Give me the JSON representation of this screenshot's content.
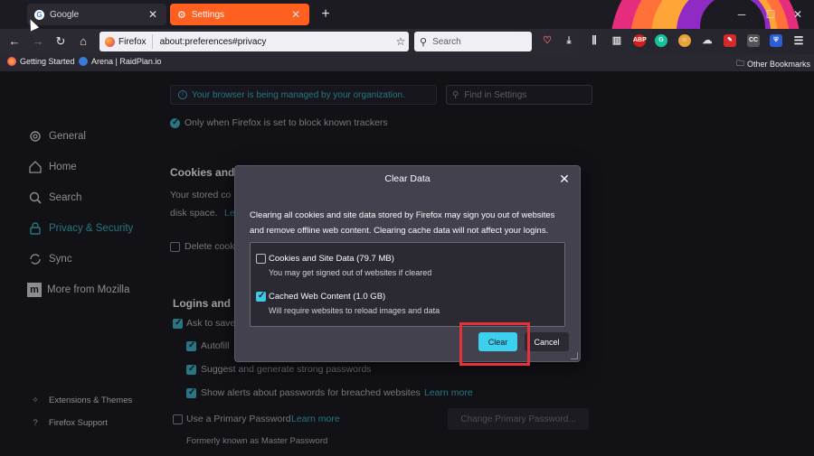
{
  "tabs": [
    {
      "title": "Google",
      "icon": "google-icon"
    },
    {
      "title": "Settings",
      "icon": "gear-icon"
    }
  ],
  "navbar": {
    "identity_label": "Firefox",
    "url": "about:preferences#privacy",
    "search_placeholder": "Search"
  },
  "bookmarks": [
    {
      "label": "Getting Started"
    },
    {
      "label": "Arena | RaidPlan.io"
    }
  ],
  "other_bookmarks": "Other Bookmarks",
  "settings": {
    "managed_notice": "Your browser is being managed by your organization.",
    "find_placeholder": "Find in Settings",
    "nav": [
      "General",
      "Home",
      "Search",
      "Privacy & Security",
      "Sync",
      "More from Mozilla"
    ],
    "footer": [
      "Extensions & Themes",
      "Firefox Support"
    ],
    "bg_only_when": "Only when Firefox is set to block known trackers",
    "cookies_heading": "Cookies and S",
    "cookies_text1": "Your stored co",
    "cookies_text2": "disk space.",
    "cookies_link": "Le",
    "delete_cookies": "Delete cook",
    "logins_heading": "Logins and P",
    "ask_to_save": "Ask to save",
    "autofill": "Autofill",
    "suggest_passwords": "Suggest and generate strong passwords",
    "show_alerts": "Show alerts about passwords for breached websites",
    "learn_more": "Learn more",
    "primary_password": "Use a Primary Password",
    "primary_learn_more": "Learn more",
    "change_primary": "Change Primary Password...",
    "formerly": "Formerly known as Master Password"
  },
  "dialog": {
    "title": "Clear Data",
    "description": "Clearing all cookies and site data stored by Firefox may sign you out of websites and remove offline web content. Clearing cache data will not affect your logins.",
    "options": [
      {
        "label": "Cookies and Site Data (79.7 MB)",
        "description": "You may get signed out of websites if cleared",
        "checked": false
      },
      {
        "label": "Cached Web Content (1.0 GB)",
        "description": "Will require websites to reload images and data",
        "checked": true
      }
    ],
    "clear_label": "Clear",
    "cancel_label": "Cancel"
  },
  "colors": {
    "accent": "#3cb5c6",
    "active_tab": "#ff5f1f",
    "highlight": "#e5323a"
  }
}
